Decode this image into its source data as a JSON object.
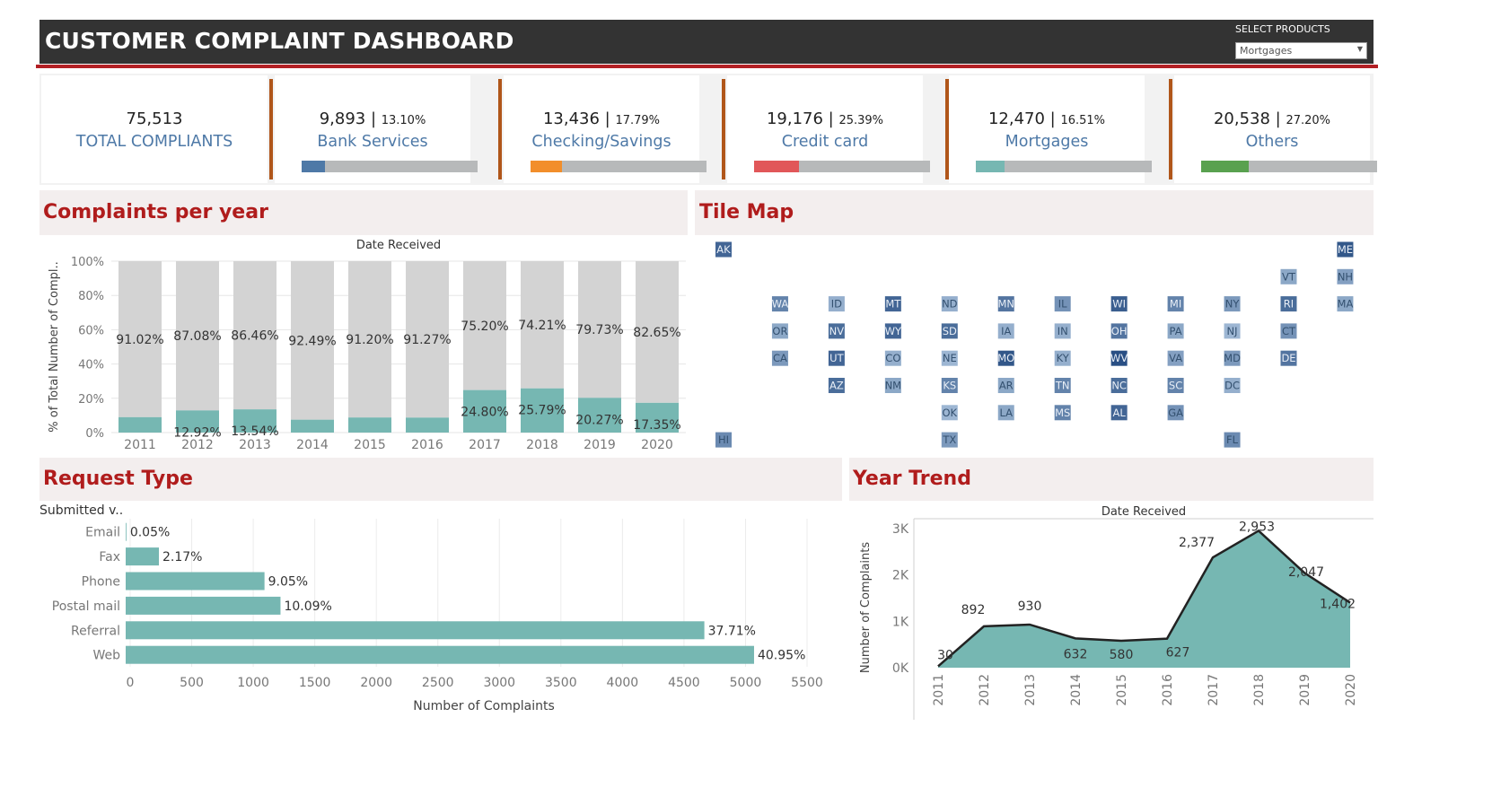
{
  "header": {
    "title": "CUSTOMER COMPLAINT DASHBOARD",
    "select_label": "SELECT PRODUCTS",
    "select_value": "Mortgages"
  },
  "kpis": {
    "total": {
      "value": "75,513",
      "label": "TOTAL COMPLIANTS"
    },
    "cards": [
      {
        "value": "9,893",
        "pct": "13.10%",
        "label": "Bank Services",
        "share": 0.131,
        "color": "#4e79a7"
      },
      {
        "value": "13,436",
        "pct": "17.79%",
        "label": "Checking/Savings",
        "share": 0.1779,
        "color": "#f28e2b"
      },
      {
        "value": "19,176",
        "pct": "25.39%",
        "label": "Credit card",
        "share": 0.2539,
        "color": "#e15759"
      },
      {
        "value": "12,470",
        "pct": "16.51%",
        "label": "Mortgages",
        "share": 0.1651,
        "color": "#76b7b2"
      },
      {
        "value": "20,538",
        "pct": "27.20%",
        "label": "Others",
        "share": 0.272,
        "color": "#59a14f"
      }
    ]
  },
  "sections": {
    "per_year": "Complaints per year",
    "tile_map": "Tile Map",
    "request_type": "Request Type",
    "year_trend": "Year Trend"
  },
  "chart_data": [
    {
      "type": "bar",
      "stacked": true,
      "title": "Date Received",
      "ylabel": "% of Total Number of Compl..",
      "categories": [
        "2011",
        "2012",
        "2013",
        "2014",
        "2015",
        "2016",
        "2017",
        "2018",
        "2019",
        "2020"
      ],
      "series": [
        {
          "values": [
            8.98,
            12.92,
            13.54,
            7.51,
            8.8,
            8.73,
            24.8,
            25.79,
            20.27,
            17.35
          ],
          "labels": [
            "",
            "12.92%",
            "13.54%",
            "",
            "",
            "",
            "24.80%",
            "25.79%",
            "20.27%",
            "17.35%"
          ],
          "color": "#76b7b2"
        },
        {
          "values": [
            91.02,
            87.08,
            86.46,
            92.49,
            91.2,
            91.27,
            75.2,
            74.21,
            79.73,
            82.65
          ],
          "labels": [
            "91.02%",
            "87.08%",
            "86.46%",
            "92.49%",
            "91.20%",
            "91.27%",
            "75.20%",
            "74.21%",
            "79.73%",
            "82.65%"
          ],
          "color": "#d3d3d3"
        }
      ],
      "yticks": [
        "0%",
        "20%",
        "40%",
        "60%",
        "80%",
        "100%"
      ],
      "ylim": [
        0,
        100
      ],
      "grid": true
    },
    {
      "type": "heatmap",
      "title": "",
      "tiles": [
        {
          "s": "AK",
          "c": 0,
          "r": 0,
          "v": 0.8
        },
        {
          "s": "ME",
          "c": 11,
          "r": 0,
          "v": 0.9
        },
        {
          "s": "VT",
          "c": 10,
          "r": 1,
          "v": 0.35
        },
        {
          "s": "NH",
          "c": 11,
          "r": 1,
          "v": 0.4
        },
        {
          "s": "WA",
          "c": 1,
          "r": 2,
          "v": 0.6
        },
        {
          "s": "ID",
          "c": 2,
          "r": 2,
          "v": 0.3
        },
        {
          "s": "MT",
          "c": 3,
          "r": 2,
          "v": 0.8
        },
        {
          "s": "ND",
          "c": 4,
          "r": 2,
          "v": 0.3
        },
        {
          "s": "MN",
          "c": 5,
          "r": 2,
          "v": 0.7
        },
        {
          "s": "IL",
          "c": 6,
          "r": 2,
          "v": 0.5
        },
        {
          "s": "WI",
          "c": 7,
          "r": 2,
          "v": 0.85
        },
        {
          "s": "MI",
          "c": 8,
          "r": 2,
          "v": 0.6
        },
        {
          "s": "NY",
          "c": 9,
          "r": 2,
          "v": 0.45
        },
        {
          "s": "RI",
          "c": 10,
          "r": 2,
          "v": 0.75
        },
        {
          "s": "MA",
          "c": 11,
          "r": 2,
          "v": 0.35
        },
        {
          "s": "OR",
          "c": 1,
          "r": 3,
          "v": 0.35
        },
        {
          "s": "NV",
          "c": 2,
          "r": 3,
          "v": 0.75
        },
        {
          "s": "WY",
          "c": 3,
          "r": 3,
          "v": 0.8
        },
        {
          "s": "SD",
          "c": 4,
          "r": 3,
          "v": 0.75
        },
        {
          "s": "IA",
          "c": 5,
          "r": 3,
          "v": 0.3
        },
        {
          "s": "IN",
          "c": 6,
          "r": 3,
          "v": 0.3
        },
        {
          "s": "OH",
          "c": 7,
          "r": 3,
          "v": 0.7
        },
        {
          "s": "PA",
          "c": 8,
          "r": 3,
          "v": 0.35
        },
        {
          "s": "NJ",
          "c": 9,
          "r": 3,
          "v": 0.25
        },
        {
          "s": "CT",
          "c": 10,
          "r": 3,
          "v": 0.5
        },
        {
          "s": "CA",
          "c": 1,
          "r": 4,
          "v": 0.45
        },
        {
          "s": "UT",
          "c": 2,
          "r": 4,
          "v": 0.8
        },
        {
          "s": "CO",
          "c": 3,
          "r": 4,
          "v": 0.3
        },
        {
          "s": "NE",
          "c": 4,
          "r": 4,
          "v": 0.25
        },
        {
          "s": "MO",
          "c": 5,
          "r": 4,
          "v": 0.9
        },
        {
          "s": "KY",
          "c": 6,
          "r": 4,
          "v": 0.3
        },
        {
          "s": "WV",
          "c": 7,
          "r": 4,
          "v": 0.95
        },
        {
          "s": "VA",
          "c": 8,
          "r": 4,
          "v": 0.4
        },
        {
          "s": "MD",
          "c": 9,
          "r": 4,
          "v": 0.45
        },
        {
          "s": "DE",
          "c": 10,
          "r": 4,
          "v": 0.7
        },
        {
          "s": "AZ",
          "c": 2,
          "r": 5,
          "v": 0.75
        },
        {
          "s": "NM",
          "c": 3,
          "r": 5,
          "v": 0.35
        },
        {
          "s": "KS",
          "c": 4,
          "r": 5,
          "v": 0.6
        },
        {
          "s": "AR",
          "c": 5,
          "r": 5,
          "v": 0.35
        },
        {
          "s": "TN",
          "c": 6,
          "r": 5,
          "v": 0.6
        },
        {
          "s": "NC",
          "c": 7,
          "r": 5,
          "v": 0.75
        },
        {
          "s": "SC",
          "c": 8,
          "r": 5,
          "v": 0.6
        },
        {
          "s": "DC",
          "c": 9,
          "r": 5,
          "v": 0.3
        },
        {
          "s": "OK",
          "c": 4,
          "r": 6,
          "v": 0.25
        },
        {
          "s": "LA",
          "c": 5,
          "r": 6,
          "v": 0.35
        },
        {
          "s": "MS",
          "c": 6,
          "r": 6,
          "v": 0.6
        },
        {
          "s": "AL",
          "c": 7,
          "r": 6,
          "v": 0.8
        },
        {
          "s": "GA",
          "c": 8,
          "r": 6,
          "v": 0.5
        },
        {
          "s": "HI",
          "c": 0,
          "r": 7,
          "v": 0.55
        },
        {
          "s": "TX",
          "c": 4,
          "r": 7,
          "v": 0.45
        },
        {
          "s": "FL",
          "c": 9,
          "r": 7,
          "v": 0.55
        }
      ]
    },
    {
      "type": "bar",
      "orientation": "horizontal",
      "title": "",
      "row_header": "Submitted v..",
      "xlabel": "Number of Complaints",
      "categories": [
        "Email",
        "Fax",
        "Phone",
        "Postal mail",
        "Referral",
        "Web"
      ],
      "values": [
        6,
        270,
        1128,
        1258,
        4702,
        5106
      ],
      "labels": [
        "0.05%",
        "2.17%",
        "9.05%",
        "10.09%",
        "37.71%",
        "40.95%"
      ],
      "xticks": [
        0,
        500,
        1000,
        1500,
        2000,
        2500,
        3000,
        3500,
        4000,
        4500,
        5000,
        5500
      ],
      "xlim": [
        0,
        5500
      ],
      "color": "#76b7b2",
      "grid": true
    },
    {
      "type": "area",
      "title": "Date Received",
      "ylabel": "Number of Complaints",
      "x": [
        "2011",
        "2012",
        "2013",
        "2014",
        "2015",
        "2016",
        "2017",
        "2018",
        "2019",
        "2020"
      ],
      "values": [
        30,
        892,
        930,
        632,
        580,
        627,
        2377,
        2953,
        2047,
        1402
      ],
      "labels": [
        "30",
        "892",
        "930",
        "632",
        "580",
        "627",
        "2,377",
        "2,953",
        "2,047",
        "1,402"
      ],
      "yticks": [
        "0K",
        "1K",
        "2K",
        "3K"
      ],
      "ylim": [
        0,
        3000
      ],
      "color": "#76b7b2"
    }
  ]
}
